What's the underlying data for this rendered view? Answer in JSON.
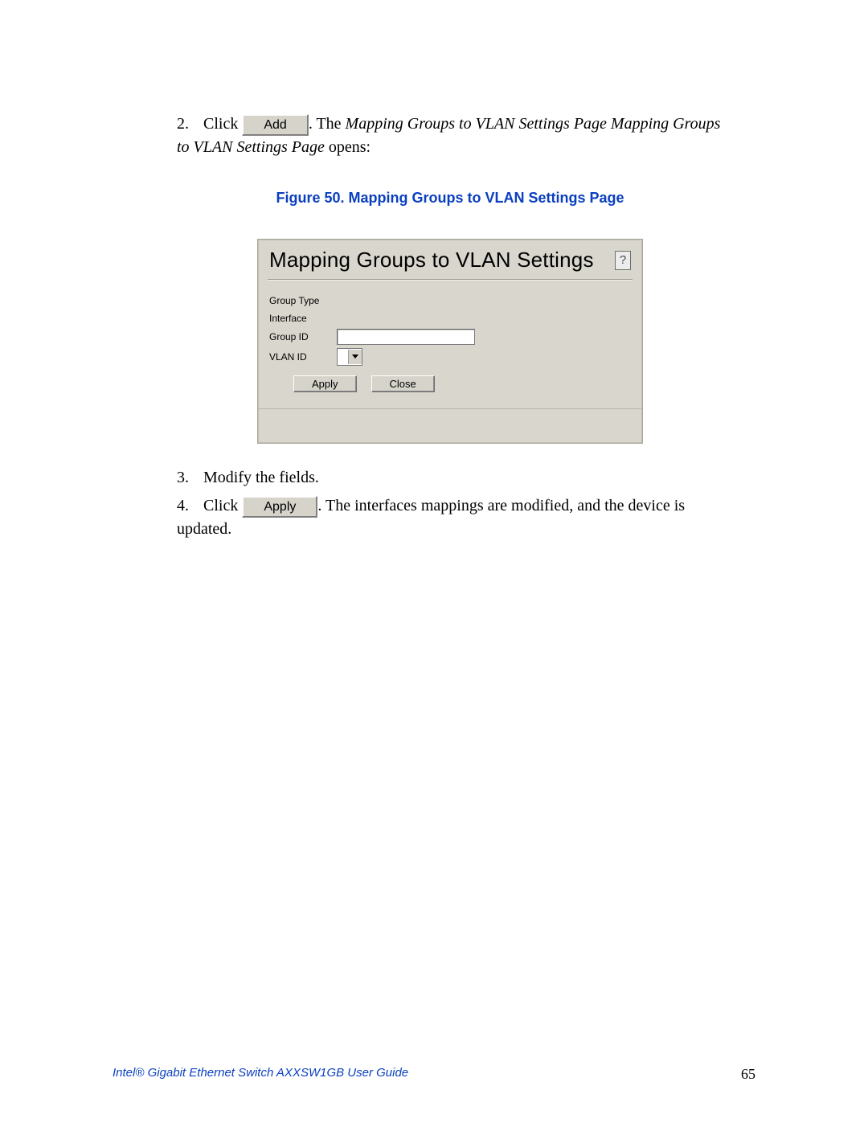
{
  "steps": {
    "s2": {
      "num": "2.",
      "click": "Click",
      "btn": "Add",
      "after1": ". The ",
      "italic1": "Mapping Groups to VLAN Settings Page Mapping Groups to VLAN Settings Page",
      "after2": " opens:"
    },
    "s3": {
      "num": "3.",
      "text": "Modify the fields."
    },
    "s4": {
      "num": "4.",
      "click": "Click",
      "btn": "Apply",
      "after": ". The interfaces mappings are modified, and the device is updated."
    }
  },
  "figure": {
    "caption": "Figure 50. Mapping Groups to VLAN Settings Page"
  },
  "dialog": {
    "title": "Mapping Groups to VLAN Settings",
    "help": "?",
    "labels": {
      "groupType": "Group Type",
      "interface": "Interface",
      "groupId": "Group ID",
      "vlanId": "VLAN ID"
    },
    "buttons": {
      "apply": "Apply",
      "close": "Close"
    }
  },
  "footer": {
    "title": "Intel® Gigabit Ethernet Switch AXXSW1GB User Guide",
    "page": "65"
  }
}
